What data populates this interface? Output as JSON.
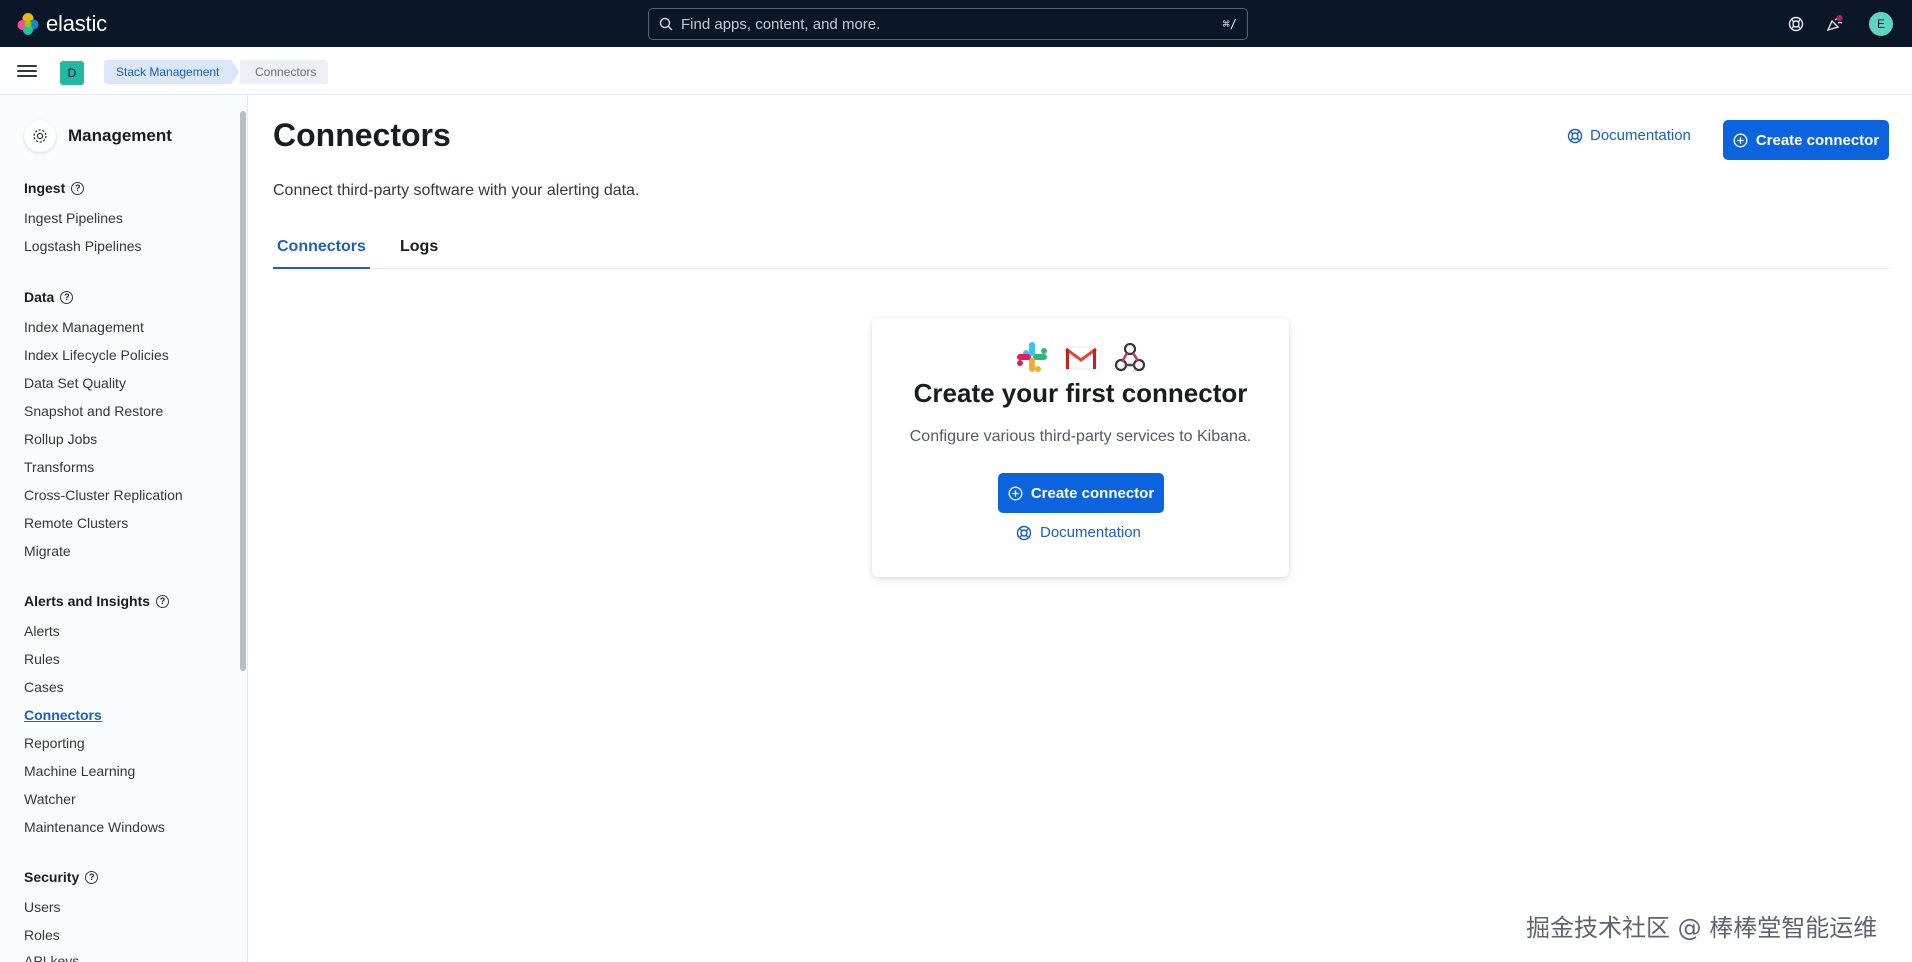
{
  "header": {
    "logo_text": "elastic",
    "search_placeholder": "Find apps, content, and more.",
    "search_shortcut": "⌘/",
    "avatar_initial": "E"
  },
  "subbar": {
    "space_initial": "D",
    "breadcrumbs": [
      "Stack Management",
      "Connectors"
    ]
  },
  "sidebar": {
    "title": "Management",
    "sections": [
      {
        "title": "Ingest",
        "items": [
          "Ingest Pipelines",
          "Logstash Pipelines"
        ]
      },
      {
        "title": "Data",
        "items": [
          "Index Management",
          "Index Lifecycle Policies",
          "Data Set Quality",
          "Snapshot and Restore",
          "Rollup Jobs",
          "Transforms",
          "Cross-Cluster Replication",
          "Remote Clusters",
          "Migrate"
        ]
      },
      {
        "title": "Alerts and Insights",
        "items": [
          "Alerts",
          "Rules",
          "Cases",
          "Connectors",
          "Reporting",
          "Machine Learning",
          "Watcher",
          "Maintenance Windows"
        ]
      },
      {
        "title": "Security",
        "items": [
          "Users",
          "Roles",
          "API keys"
        ]
      }
    ],
    "active_item": "Connectors"
  },
  "main": {
    "title": "Connectors",
    "description": "Connect third-party software with your alerting data.",
    "documentation_label": "Documentation",
    "create_label": "Create connector",
    "tabs": [
      "Connectors",
      "Logs"
    ],
    "active_tab": "Connectors"
  },
  "empty_state": {
    "title": "Create your first connector",
    "description": "Configure various third-party services to Kibana.",
    "create_label": "Create connector",
    "documentation_label": "Documentation"
  },
  "watermark": "掘金技术社区 @ 棒棒堂智能运维",
  "colors": {
    "header_bg": "#0b1628",
    "primary": "#0b64dd",
    "link": "#1d5ec0"
  }
}
